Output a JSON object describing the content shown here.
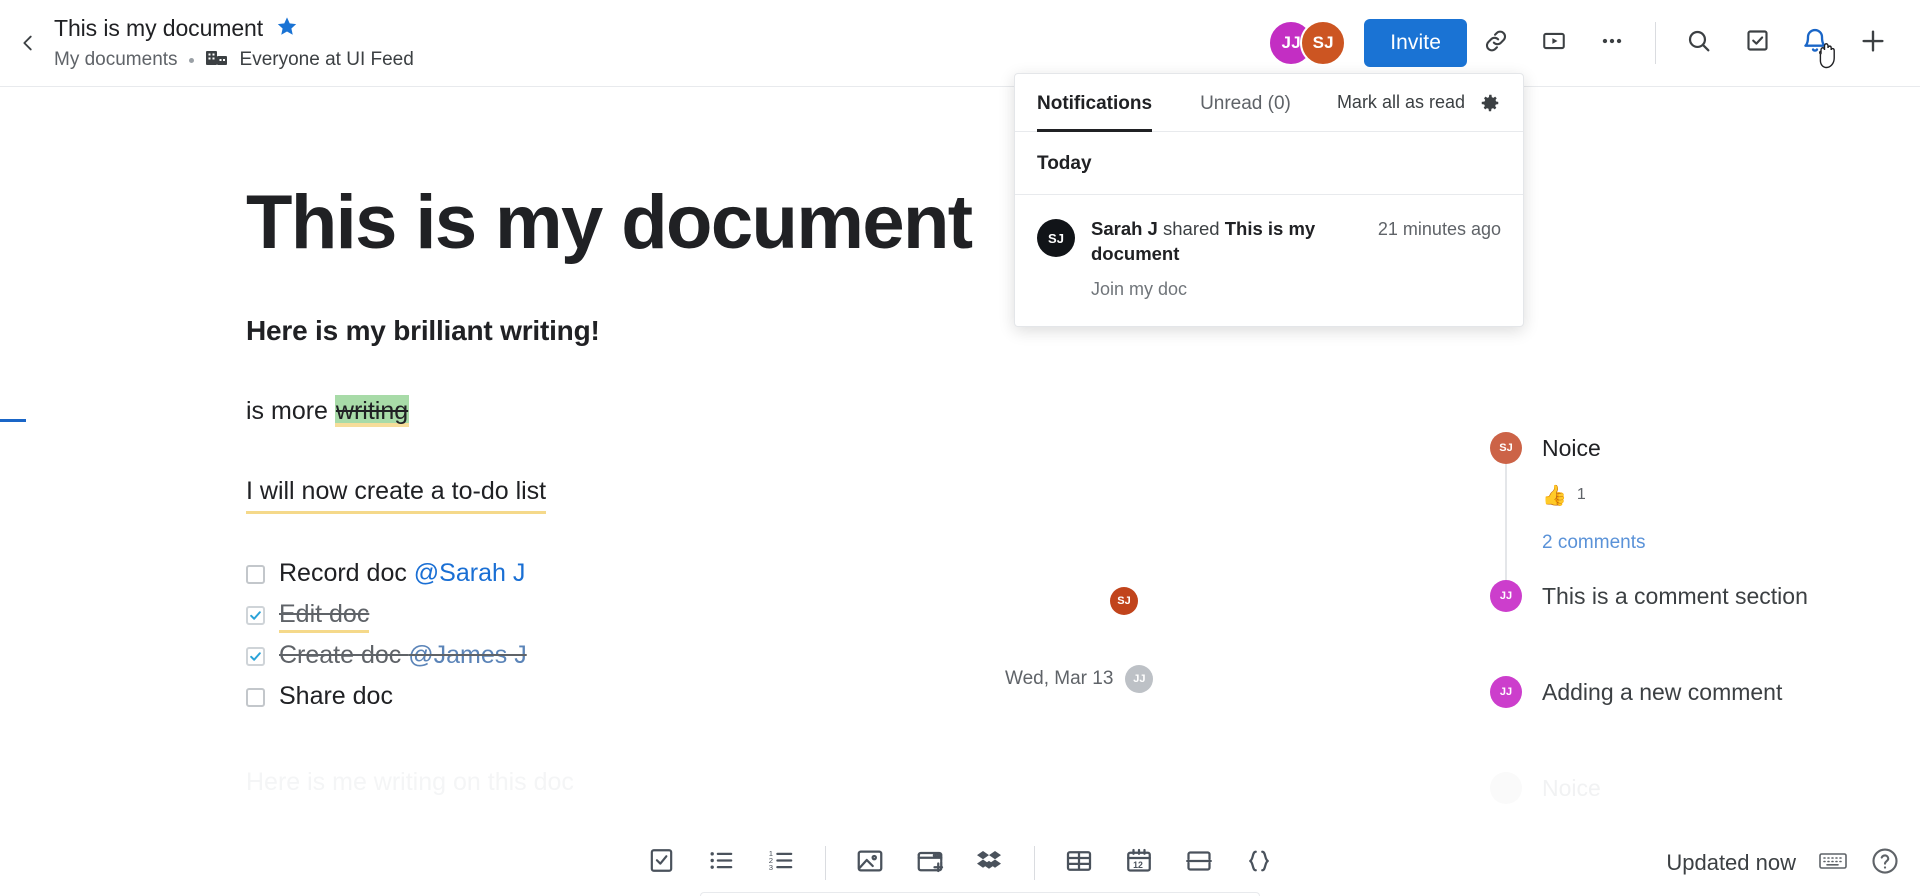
{
  "header": {
    "back_icon": "chevron-left-icon",
    "doc_title": "This is my document",
    "star_icon": "star-filled-icon",
    "breadcrumb_parent": "My documents",
    "breadcrumb_org": "Everyone at UI Feed",
    "org_icon": "building-icon",
    "avatars": [
      {
        "initials": "JJ",
        "color": "#c32ec3"
      },
      {
        "initials": "SJ",
        "color": "#cc5522"
      }
    ],
    "invite_label": "Invite",
    "icons": [
      {
        "name": "link-icon"
      },
      {
        "name": "video-play-icon"
      },
      {
        "name": "more-horizontal-icon"
      },
      {
        "name": "search-icon"
      },
      {
        "name": "task-checkbox-icon"
      },
      {
        "name": "bell-icon"
      },
      {
        "name": "plus-icon"
      }
    ],
    "accent_color": "#1a73d4",
    "bell_active_color": "#1a66c7"
  },
  "notifications": {
    "tab_all": "Notifications",
    "tab_unread": "Unread (0)",
    "mark_all": "Mark all as read",
    "settings_icon": "gear-icon",
    "group_label": "Today",
    "items": [
      {
        "avatar_initials": "SJ",
        "actor": "Sarah J",
        "action": "shared",
        "target": "This is my document",
        "preview": "Join my doc",
        "time": "21 minutes ago"
      }
    ]
  },
  "document": {
    "heading": "This is my document",
    "subheading": "Here is my brilliant writing!",
    "para_prefix": "is more ",
    "para_struck": "writing",
    "para_todo_intro": "I will now create a to-do list",
    "placeholder": "Here is me writing on this doc",
    "todos": [
      {
        "label": "Record doc ",
        "mention": "@Sarah J",
        "checked": false,
        "underlined": false
      },
      {
        "label": "Edit doc",
        "mention": "",
        "checked": true,
        "underlined": true
      },
      {
        "label": "Create doc ",
        "mention": "@James J",
        "checked": true,
        "underlined": false
      },
      {
        "label": "Share doc",
        "mention": "",
        "checked": false,
        "underlined": false
      }
    ],
    "inline_marker_initials": "SJ",
    "date_marker": "Wed, Mar 13",
    "date_marker_initials": "JJ"
  },
  "comments": [
    {
      "initials": "SJ",
      "text": "Noice",
      "reaction_emoji": "thumbs-up",
      "reaction_count": "1",
      "replies_label": "2 comments"
    },
    {
      "initials": "JJ",
      "text": "This is a comment section"
    },
    {
      "initials": "JJ",
      "text": "Adding a new comment"
    },
    {
      "initials": "SJ",
      "text": "Noice"
    }
  ],
  "bottom_toolbar": {
    "tools": [
      {
        "name": "checkbox-list-icon"
      },
      {
        "name": "bullet-list-icon"
      },
      {
        "name": "numbered-list-icon"
      },
      {
        "name": "image-icon"
      },
      {
        "name": "embed-window-icon"
      },
      {
        "name": "dropbox-icon"
      },
      {
        "name": "table-icon"
      },
      {
        "name": "calendar-icon"
      },
      {
        "name": "divider-block-icon"
      },
      {
        "name": "code-braces-icon"
      }
    ],
    "calendar_day": "12",
    "code_label": "{ }"
  },
  "status": {
    "updated_text": "Updated now",
    "keyboard_icon": "keyboard-icon",
    "help_icon": "help-circle-icon"
  }
}
